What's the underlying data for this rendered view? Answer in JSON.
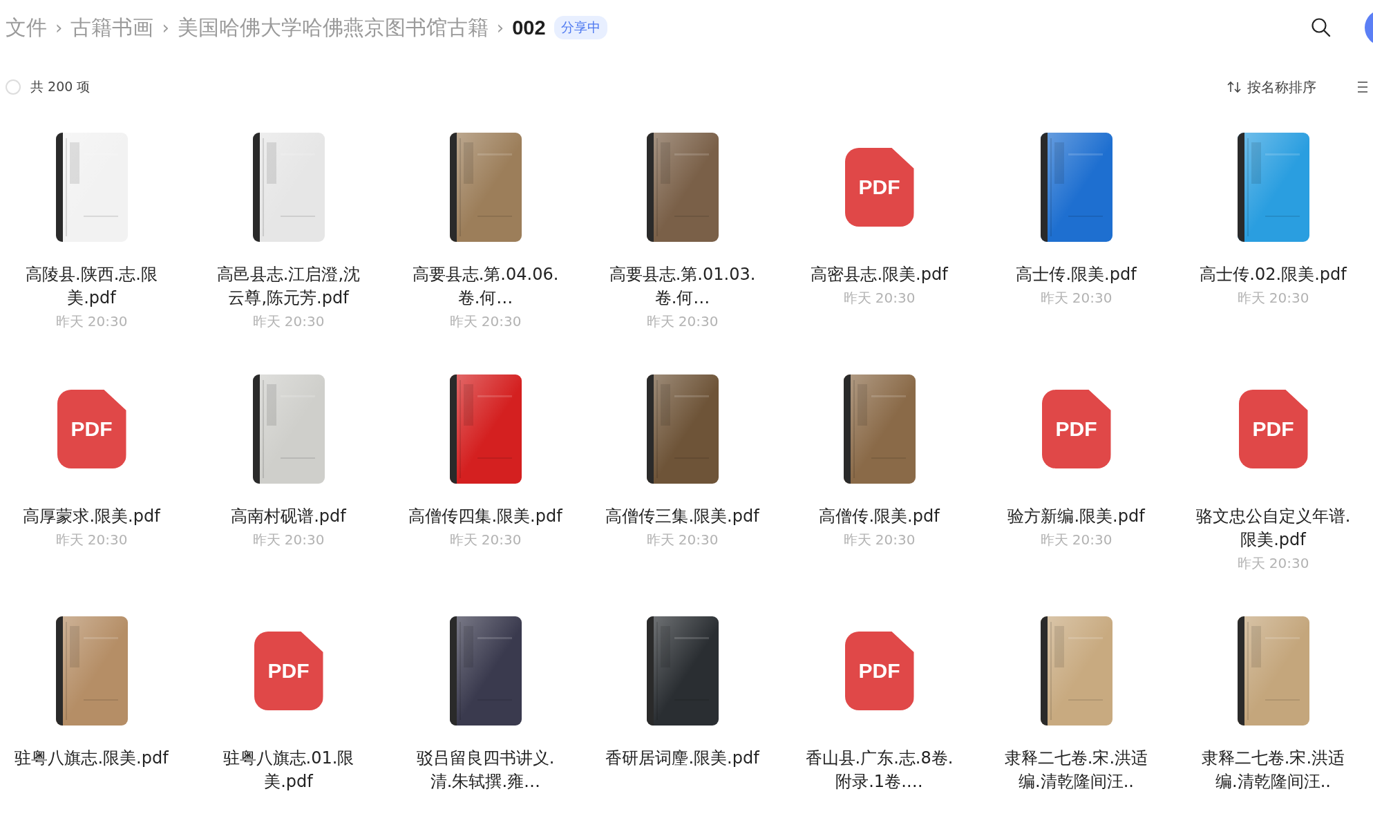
{
  "breadcrumb": [
    {
      "label": "文件",
      "current": false
    },
    {
      "label": "古籍书画",
      "current": false
    },
    {
      "label": "美国哈佛大学哈佛燕京图书馆古籍",
      "current": false
    },
    {
      "label": "002",
      "current": true
    }
  ],
  "breadcrumb_separator": "›",
  "share_badge": "分享中",
  "toolbar": {
    "select_all_checked": false,
    "count": "共 200 项",
    "sort_label": "按名称排序"
  },
  "files": [
    {
      "name": "高陵县.陕西.志.限美.pdf",
      "time": "昨天 20:30",
      "kind": "cover",
      "color": "#f2f2f2"
    },
    {
      "name": "高邑县志.江启澄,沈云尊,陈元芳.pdf",
      "time": "昨天 20:30",
      "kind": "cover",
      "color": "#e6e6e6"
    },
    {
      "name": "高要县志.第.04.06.卷.何…",
      "time": "昨天 20:30",
      "kind": "cover",
      "color": "#9c7e5a"
    },
    {
      "name": "高要县志.第.01.03.卷.何…",
      "time": "昨天 20:30",
      "kind": "cover",
      "color": "#7a6048"
    },
    {
      "name": "高密县志.限美.pdf",
      "time": "昨天 20:30",
      "kind": "pdf",
      "badge": "PDF"
    },
    {
      "name": "高士传.限美.pdf",
      "time": "昨天 20:30",
      "kind": "cover",
      "color": "#1e6fd0"
    },
    {
      "name": "高士传.02.限美.pdf",
      "time": "昨天 20:30",
      "kind": "cover",
      "color": "#2a9ee0"
    },
    {
      "name": "高厚蒙求.限美.pdf",
      "time": "昨天 20:30",
      "kind": "pdf",
      "badge": "PDF"
    },
    {
      "name": "高南村砚谱.pdf",
      "time": "昨天 20:30",
      "kind": "cover",
      "color": "#cfcfcb"
    },
    {
      "name": "高僧传四集.限美.pdf",
      "time": "昨天 20:30",
      "kind": "cover",
      "color": "#d42020"
    },
    {
      "name": "高僧传三集.限美.pdf",
      "time": "昨天 20:30",
      "kind": "cover",
      "color": "#6e5438"
    },
    {
      "name": "高僧传.限美.pdf",
      "time": "昨天 20:30",
      "kind": "cover",
      "color": "#8a6a48"
    },
    {
      "name": "验方新编.限美.pdf",
      "time": "昨天 20:30",
      "kind": "pdf",
      "badge": "PDF"
    },
    {
      "name": "骆文忠公自定义年谱.限美.pdf",
      "time": "昨天 20:30",
      "kind": "pdf",
      "badge": "PDF"
    },
    {
      "name": "驻粤八旗志.限美.pdf",
      "kind": "cover",
      "color": "#b58e66"
    },
    {
      "name": "驻粤八旗志.01.限美.pdf",
      "kind": "pdf",
      "badge": "PDF"
    },
    {
      "name": "驳吕留良四书讲义.清.朱轼撰.雍…",
      "kind": "cover",
      "color": "#3a3a4e"
    },
    {
      "name": "香研居词麈.限美.pdf",
      "kind": "cover",
      "color": "#2a2e32"
    },
    {
      "name": "香山县.广东.志.8卷.附录.1卷.…",
      "kind": "pdf",
      "badge": "PDF"
    },
    {
      "name": "隶释二七卷.宋.洪适编.清乾隆间汪..",
      "kind": "cover",
      "color": "#c8aa80"
    },
    {
      "name": "隶释二七卷.宋.洪适编.清乾隆间汪..",
      "kind": "cover",
      "color": "#c4a67c"
    }
  ]
}
